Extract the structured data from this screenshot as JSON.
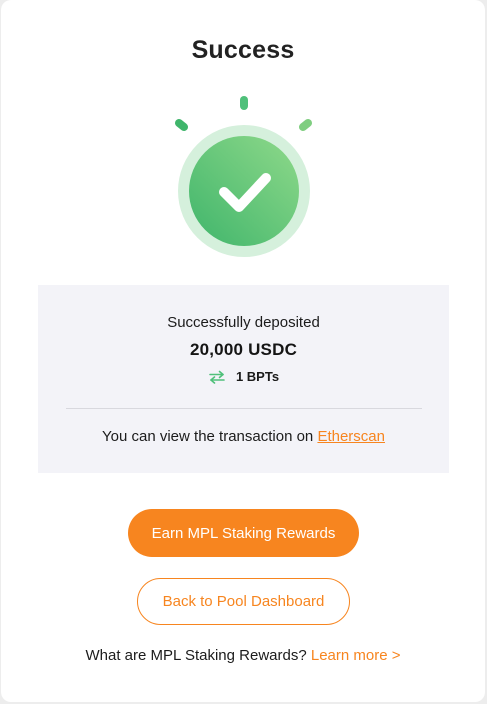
{
  "modal": {
    "title": "Success"
  },
  "summary": {
    "label": "Successfully deposited",
    "amount": "20,000 USDC",
    "received": "1 BPTs",
    "transaction_text": "You can view the transaction on ",
    "transaction_link": "Etherscan"
  },
  "actions": {
    "primary_label": "Earn MPL Staking Rewards",
    "secondary_label": "Back to Pool Dashboard"
  },
  "footer": {
    "question": "What are MPL Staking Rewards? ",
    "link": "Learn more >"
  },
  "icons": {
    "status": "checkmark-icon",
    "swap": "swap-arrows-icon"
  },
  "colors": {
    "accent": "#f7851f",
    "success": "#4fc07a",
    "success_light": "#d5f0dc",
    "panel": "#f3f3f8"
  }
}
